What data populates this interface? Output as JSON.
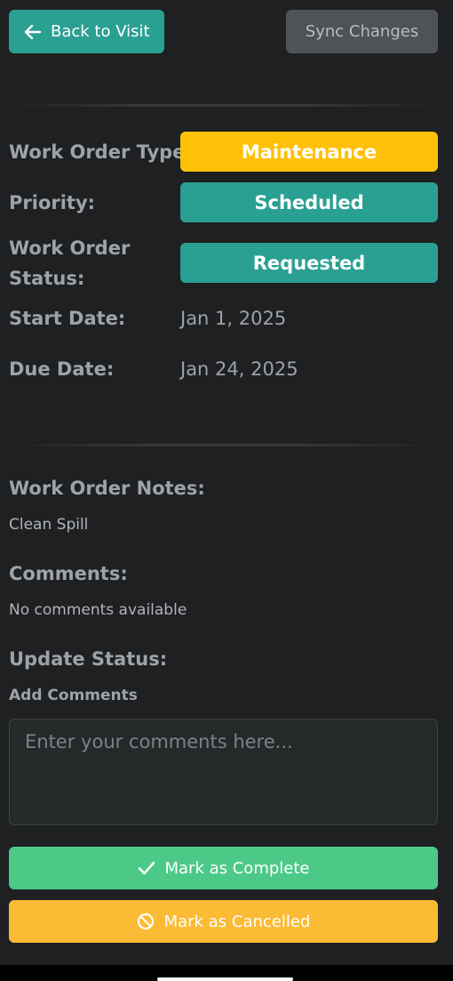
{
  "header": {
    "back_label": "Back to Visit",
    "sync_label": "Sync Changes"
  },
  "details": {
    "type_label": "Work Order Type:",
    "type_value": "Maintenance",
    "priority_label": "Priority:",
    "priority_value": "Scheduled",
    "status_label_line1": "Work Order",
    "status_label_line2": "Status:",
    "status_value": "Requested",
    "start_label": "Start Date:",
    "start_value": "Jan 1, 2025",
    "due_label": "Due Date:",
    "due_value": "Jan 24, 2025"
  },
  "notes": {
    "label": "Work Order Notes:",
    "text": "Clean Spill"
  },
  "comments": {
    "label": "Comments:",
    "text": "No comments available"
  },
  "update": {
    "label": "Update Status:",
    "add_comments_label": "Add Comments",
    "placeholder": "Enter your comments here...",
    "complete_label": "Mark as Complete",
    "cancel_label": "Mark as Cancelled"
  },
  "colors": {
    "teal": "#2aa092",
    "yellow": "#ffc107",
    "green": "#4cc987",
    "orange": "#fbbb34",
    "gray_button": "#4f5357",
    "background": "#1f2022"
  },
  "icons": {
    "back": "arrow-left-icon",
    "complete": "check-icon",
    "cancel": "ban-icon"
  }
}
